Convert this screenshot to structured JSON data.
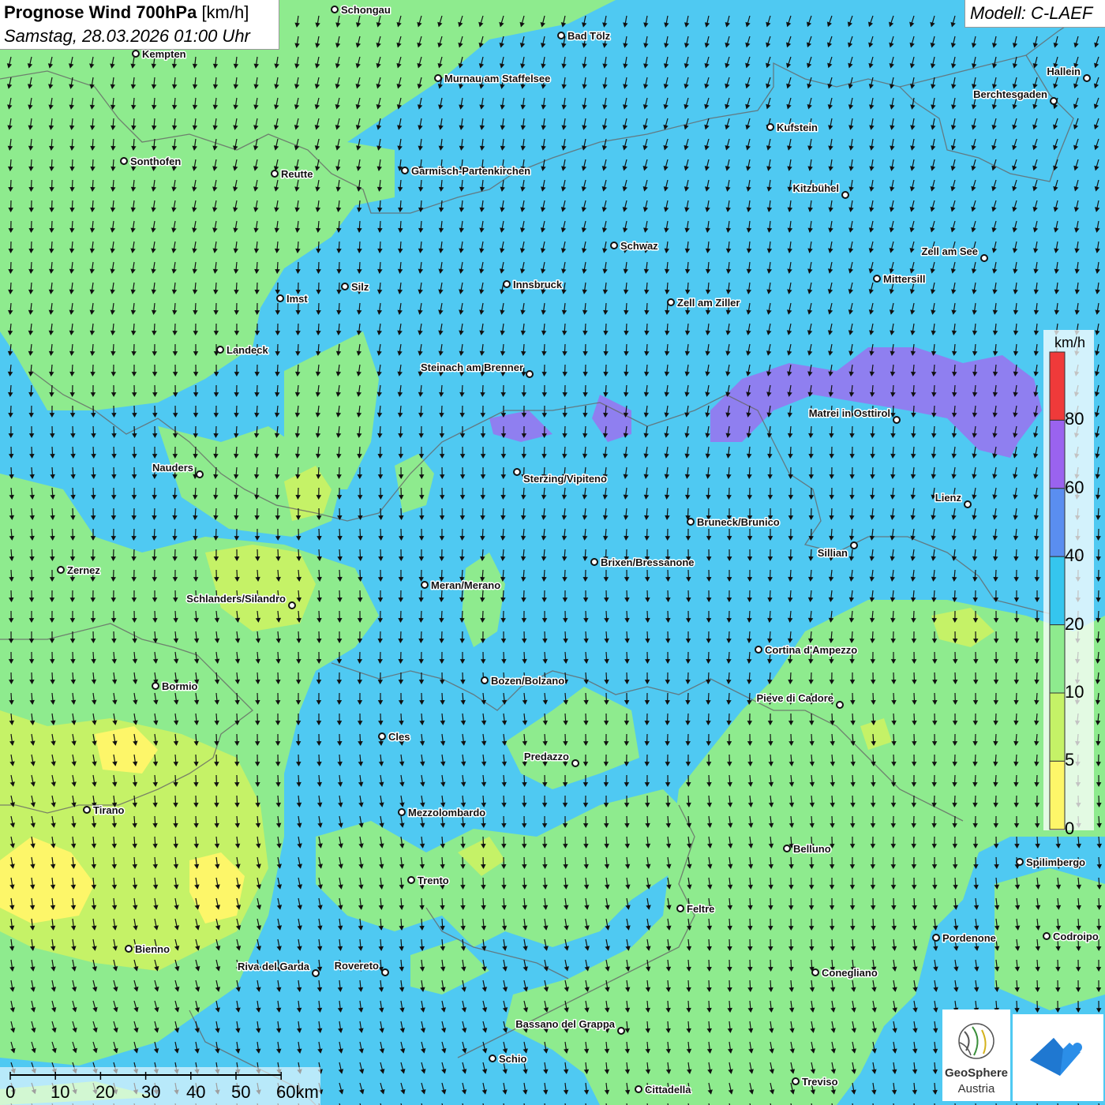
{
  "title": {
    "bold": "Prognose Wind 700hPa",
    "unit": "[km/h]",
    "datetime": "Samstag, 28.03.2026 01:00 Uhr"
  },
  "model": "Modell: C-LAEF",
  "legend": {
    "unit": "km/h",
    "labels": [
      "80",
      "60",
      "40",
      "20",
      "10",
      "5",
      "0"
    ],
    "colors": [
      "#ef3a3a",
      "#9a63ef",
      "#5a8ef0",
      "#35c6ee",
      "#8eeb8e",
      "#c5f267",
      "#fdf669"
    ]
  },
  "scalebar": {
    "labels": [
      "0",
      "10",
      "20",
      "30",
      "40",
      "50",
      "60km"
    ]
  },
  "logos": {
    "geosphere_line1": "GeoSphere",
    "geosphere_line2": "Austria"
  },
  "cities": [
    {
      "name": "Schongau"
    },
    {
      "name": "Bad Tölz"
    },
    {
      "name": "Kempten"
    },
    {
      "name": "Murnau am Staffelsee"
    },
    {
      "name": "Hallein"
    },
    {
      "name": "Berchtesgaden"
    },
    {
      "name": "Kufstein"
    },
    {
      "name": "Sonthofen"
    },
    {
      "name": "Reutte"
    },
    {
      "name": "Garmisch-Partenkirchen"
    },
    {
      "name": "Kitzbühel"
    },
    {
      "name": "Schwaz"
    },
    {
      "name": "Zell am See"
    },
    {
      "name": "Silz"
    },
    {
      "name": "Innsbruck"
    },
    {
      "name": "Mittersill"
    },
    {
      "name": "Imst"
    },
    {
      "name": "Zell am Ziller"
    },
    {
      "name": "Landeck"
    },
    {
      "name": "Steinach am Brenner"
    },
    {
      "name": "Matrei in Osttirol"
    },
    {
      "name": "Nauders"
    },
    {
      "name": "Sterzing/Vipiteno"
    },
    {
      "name": "Lienz"
    },
    {
      "name": "Bruneck/Brunico"
    },
    {
      "name": "Sillian"
    },
    {
      "name": "Zernez"
    },
    {
      "name": "Brixen/Bressanone"
    },
    {
      "name": "Meran/Merano"
    },
    {
      "name": "Schlanders/Silandro"
    },
    {
      "name": "Cortina d'Ampezzo"
    },
    {
      "name": "Bozen/Bolzano"
    },
    {
      "name": "Bormio"
    },
    {
      "name": "Pieve di Cadore"
    },
    {
      "name": "Cles"
    },
    {
      "name": "Predazzo"
    },
    {
      "name": "Tirano"
    },
    {
      "name": "Mezzolombardo"
    },
    {
      "name": "Belluno"
    },
    {
      "name": "Spilimbergo"
    },
    {
      "name": "Trento"
    },
    {
      "name": "Feltre"
    },
    {
      "name": "Pordenone"
    },
    {
      "name": "Codroipo"
    },
    {
      "name": "Bienno"
    },
    {
      "name": "Riva del Garda"
    },
    {
      "name": "Rovereto"
    },
    {
      "name": "Conegliano"
    },
    {
      "name": "Bassano del Grappa"
    },
    {
      "name": "Schio"
    },
    {
      "name": "Treviso"
    },
    {
      "name": "Cittadella"
    }
  ],
  "colors": {
    "calm": "#fdf669",
    "light": "#c5f267",
    "moderate": "#8eeb8e",
    "fresh": "#35c6ee",
    "strong": "#5a8ef0",
    "very_strong": "#9a63ef",
    "extreme": "#ef3a3a"
  }
}
